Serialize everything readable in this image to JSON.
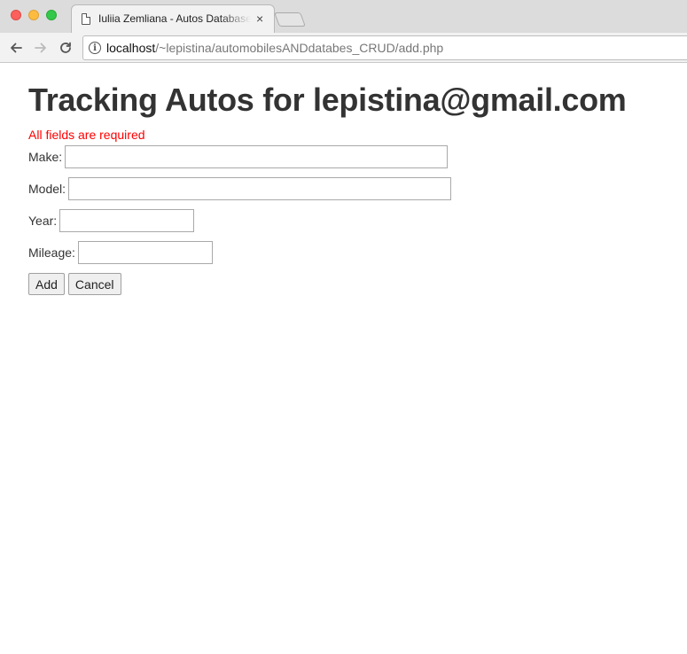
{
  "browser": {
    "tab_title": "Iuliia Zemliana - Autos Database",
    "tab_close": "×",
    "url_host": "localhost",
    "url_path": "/~lepistina/automobilesANDdatabes_CRUD/add.php"
  },
  "page": {
    "heading": "Tracking Autos for lepistina@gmail.com",
    "error_message": "All fields are required",
    "error_color": "#ff0000",
    "fields": {
      "make_label": "Make:",
      "make_value": "",
      "model_label": "Model:",
      "model_value": "",
      "year_label": "Year:",
      "year_value": "",
      "mileage_label": "Mileage:",
      "mileage_value": ""
    },
    "buttons": {
      "add_label": "Add",
      "cancel_label": "Cancel"
    }
  },
  "icons": {
    "back": "arrow-left-icon",
    "forward": "arrow-right-icon",
    "reload": "reload-icon",
    "site_info": "info-icon",
    "tab_page": "document-icon"
  }
}
